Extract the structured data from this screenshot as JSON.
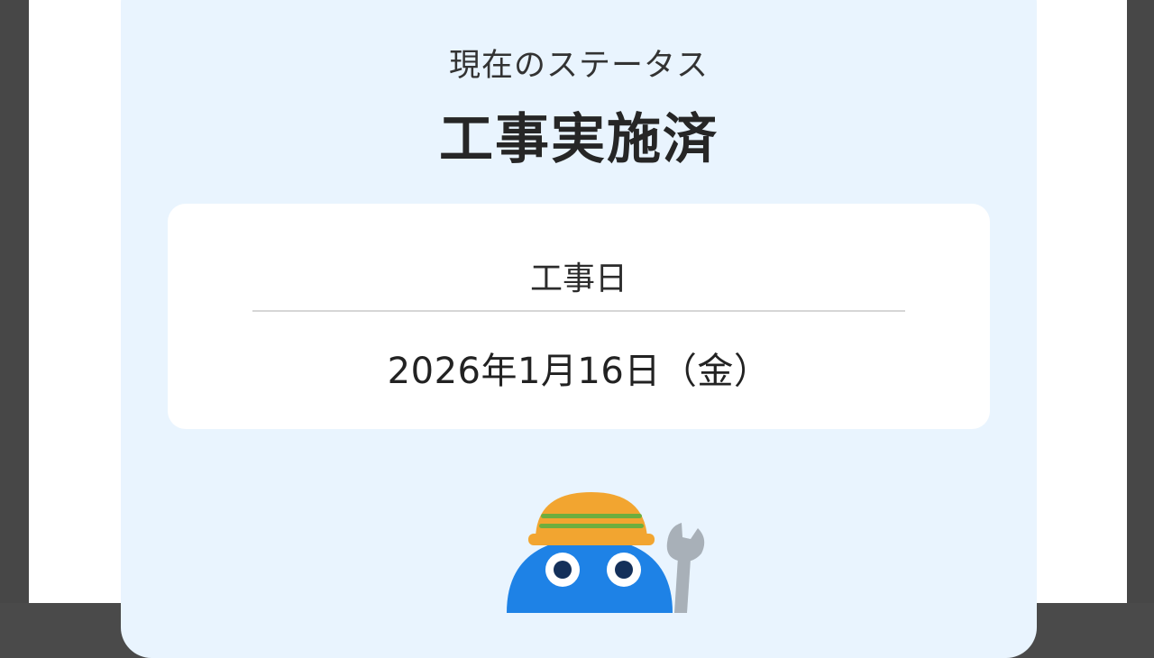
{
  "status": {
    "label": "現在のステータス",
    "value": "工事実施済"
  },
  "schedule": {
    "label": "工事日",
    "date": "2026年1月16日（金）"
  },
  "mascot": {
    "icon": "worker-mascot-icon",
    "colors": {
      "body": "#1e82e6",
      "helmet": "#f2a530",
      "helmet_stripe": "#6dae3e",
      "wrench": "#a8b0b8"
    }
  },
  "colors": {
    "card_background": "#e9f4fe",
    "inner_card_background": "#ffffff",
    "frame": "#474747"
  }
}
